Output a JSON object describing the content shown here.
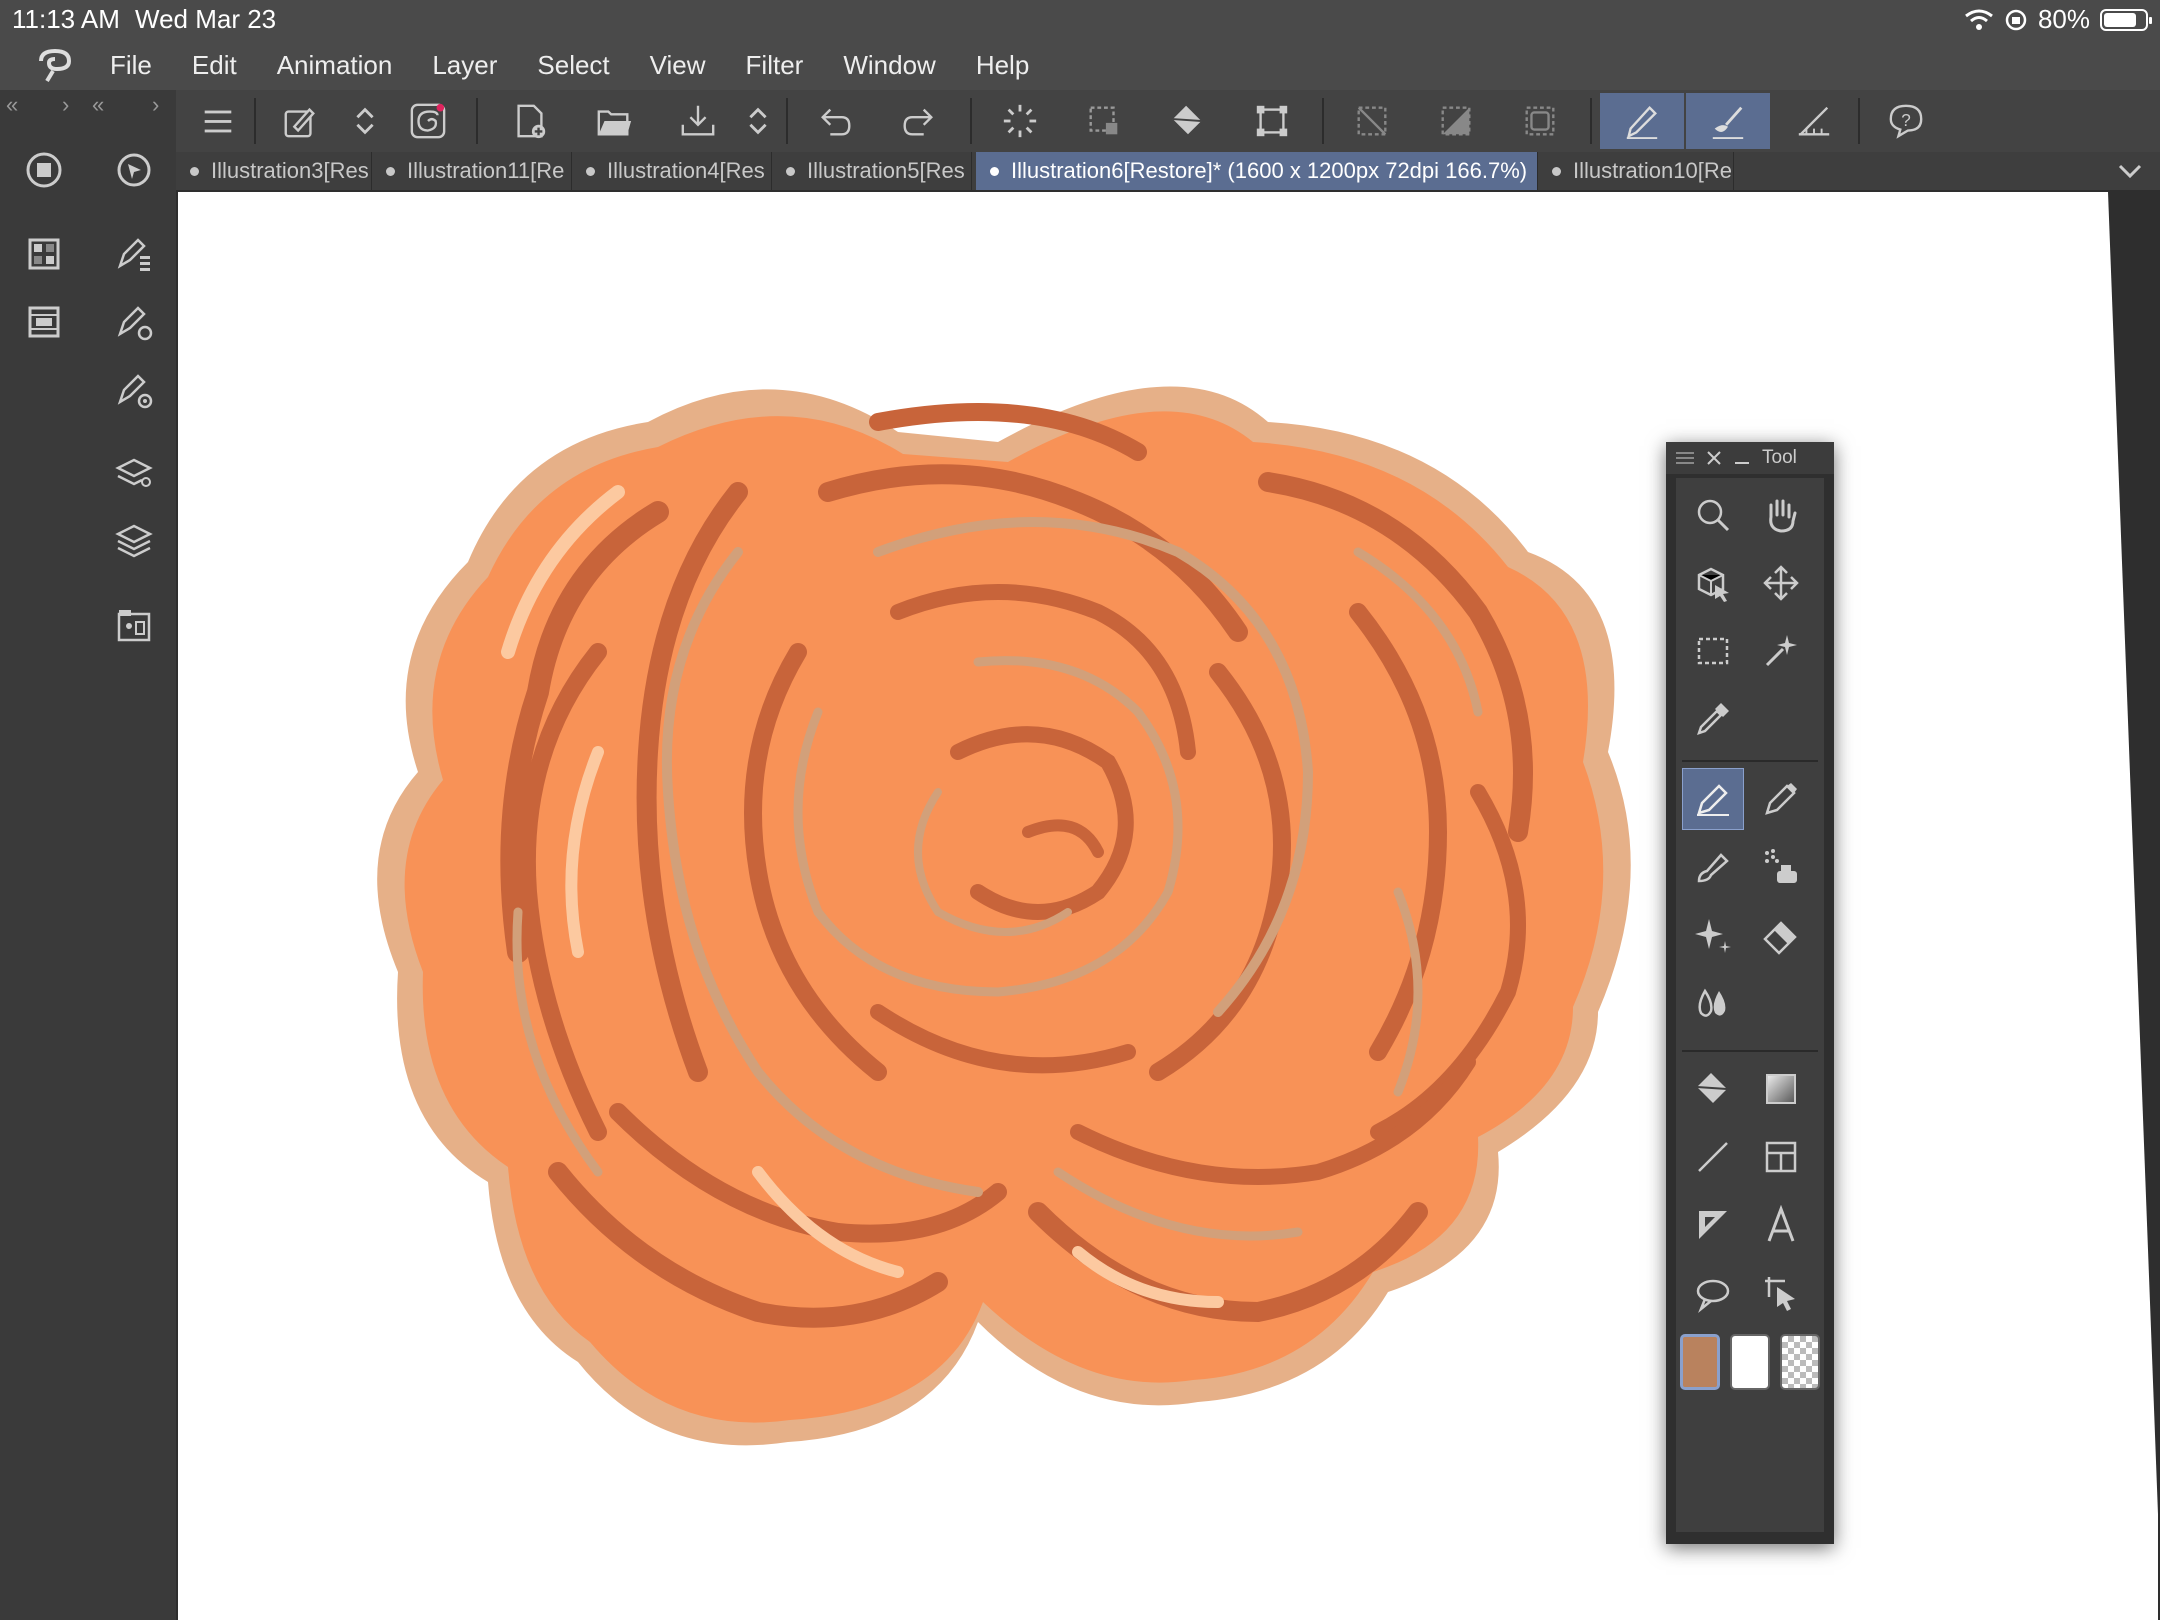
{
  "status_bar": {
    "time": "11:13 AM",
    "date": "Wed Mar 23",
    "battery": "80%",
    "battery_level": 0.8
  },
  "menu": [
    "File",
    "Edit",
    "Animation",
    "Layer",
    "Select",
    "View",
    "Filter",
    "Window",
    "Help"
  ],
  "toolbar_icons": [
    "menu-icon",
    "edit-icon",
    "up-down-icon",
    "spiral-icon",
    "new-canvas-icon",
    "open-folder-icon",
    "save-icon",
    "up-down-icon",
    "undo-icon",
    "redo-icon",
    "loading-icon",
    "selection-icon",
    "fill-icon",
    "transform-icon",
    "deselect-icon",
    "invert-selection-icon",
    "crop-icon",
    "pen-mode-icon",
    "brush-mode-icon",
    "ruler-icon",
    "help-icon"
  ],
  "tabs": [
    {
      "label": "Illustration3[Res",
      "active": false
    },
    {
      "label": "Illustration11[Re",
      "active": false
    },
    {
      "label": "Illustration4[Res",
      "active": false
    },
    {
      "label": "Illustration5[Res",
      "active": false
    },
    {
      "label": "Illustration6[Restore]* (1600 x 1200px 72dpi 166.7%)",
      "active": true
    },
    {
      "label": "Illustration10[Re",
      "active": false
    }
  ],
  "tool_palette": {
    "title": "Tool",
    "tools": [
      "zoom-icon",
      "hand-icon",
      "object-icon",
      "move-icon",
      "rect-select-icon",
      "magic-wand-icon",
      "eyedropper-icon",
      "pen-icon",
      "pencil-icon",
      "brush-icon",
      "airbrush-icon",
      "decoration-icon",
      "eraser-icon",
      "blend-icon",
      "fill-icon",
      "gradient-icon",
      "line-icon",
      "frame-icon",
      "ruler-icon",
      "text-icon",
      "balloon-icon",
      "correct-line-icon"
    ],
    "active_tool": "pen-icon",
    "colors": {
      "main": "#b9825e",
      "sub": "#ffffff"
    }
  },
  "colors": {
    "accent": "#5b6d91",
    "petal_light": "#f89257",
    "petal_dark": "#c8643a",
    "petal_edge": "#e0a880"
  }
}
